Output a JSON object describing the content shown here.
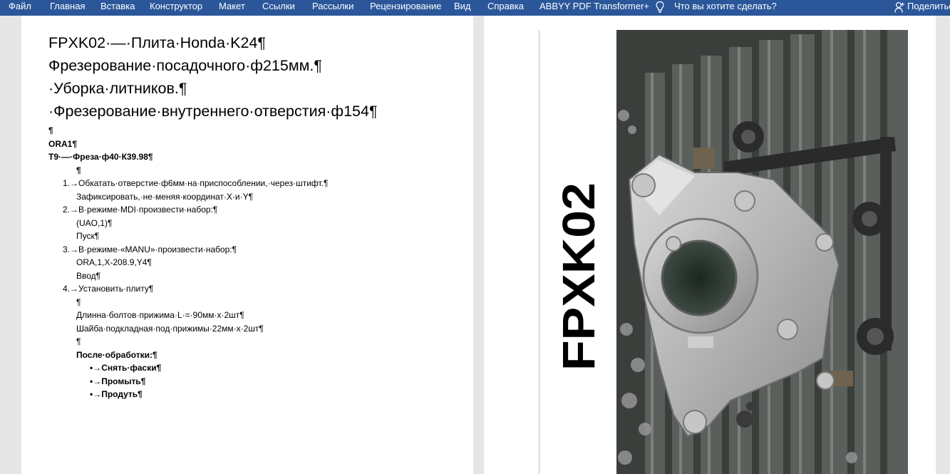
{
  "ribbon": {
    "tabs": [
      {
        "label": "Файл"
      },
      {
        "label": "Главная"
      },
      {
        "label": "Вставка"
      },
      {
        "label": "Конструктор"
      },
      {
        "label": "Макет"
      },
      {
        "label": "Ссылки"
      },
      {
        "label": "Рассылки"
      },
      {
        "label": "Рецензирование"
      },
      {
        "label": "Вид"
      },
      {
        "label": "Справка"
      },
      {
        "label": "ABBYY PDF Transformer+"
      }
    ],
    "tell_me": "Что вы хотите сделать?",
    "share": "Поделиться",
    "color": "#2b579a"
  },
  "doc": {
    "headings": [
      "FPXK02·—·Плита·Honda·K24¶",
      "Фрезерование·посадочного·ф215мм.¶",
      "·Уборка·литников.¶",
      "·Фрезерование·внутреннего·отверстия·ф154¶"
    ],
    "blank1": "¶",
    "ora1": "ORA1¶",
    "tool": "T9·—·Фреза·ф40·К39.98¶",
    "blank2": "¶",
    "steps": [
      {
        "num": "1.→",
        "text": "Обкатать·отверстие·ф6мм·на·приспособлении,·через·штифт.¶"
      },
      {
        "sub": "Зафиксировать,·не·меняя·координат·X·и·Y¶"
      },
      {
        "num": "2.→",
        "text": "В·режиме·MDI·произвести·набор:¶"
      },
      {
        "sub": "(UAO,1)¶"
      },
      {
        "sub": "Пуск¶"
      },
      {
        "num": "3.→",
        "text": "В·режиме·«MANU»·произвести·набор:¶"
      },
      {
        "sub": "ORA,1,X-208.9,Y4¶"
      },
      {
        "sub": "Ввод¶"
      },
      {
        "num": "4.→",
        "text": "Установить·плиту¶"
      },
      {
        "sub": "¶"
      },
      {
        "sub": "Длинна·болтов·прижима·L·=·90мм·х·2шт¶"
      },
      {
        "sub": "Шайба·подкладная·под·прижимы·22мм·х·2шт¶"
      },
      {
        "sub": "¶"
      }
    ],
    "after_title": "После·обработки:¶",
    "after_items": [
      "•→Снять·фаски¶",
      "•→Промыть¶",
      "•→Продуть¶"
    ],
    "side_label": "FPXK02"
  }
}
